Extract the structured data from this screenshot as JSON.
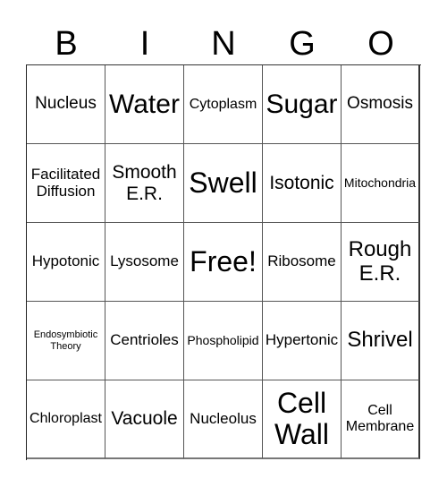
{
  "header": {
    "letters": [
      "B",
      "I",
      "N",
      "G",
      "O"
    ]
  },
  "cells": [
    "Nucleus",
    "Water",
    "Cytoplasm",
    "Sugar",
    "Osmosis",
    "Facilitated Diffusion",
    "Smooth E.R.",
    "Swell",
    "Isotonic",
    "Mitochondria",
    "Hypotonic",
    "Lysosome",
    "Free!",
    "Ribosome",
    "Rough E.R.",
    "Endosymbiotic Theory",
    "Centrioles",
    "Phospholipid",
    "Hypertonic",
    "Shrivel",
    "Chloroplast",
    "Vacuole",
    "Nucleolus",
    "Cell Wall",
    "Cell Membrane"
  ]
}
